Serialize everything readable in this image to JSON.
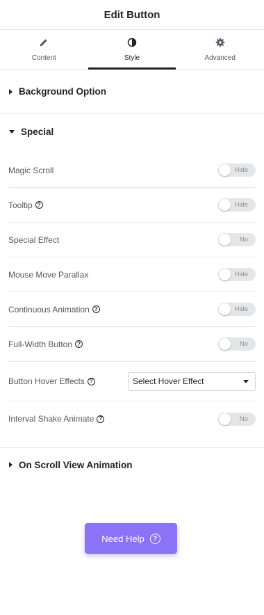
{
  "header": {
    "title": "Edit Button"
  },
  "tabs": [
    {
      "label": "Content",
      "icon": "pencil-icon"
    },
    {
      "label": "Style",
      "icon": "contrast-icon"
    },
    {
      "label": "Advanced",
      "icon": "gear-icon"
    }
  ],
  "active_tab": "Style",
  "sections": {
    "background": {
      "title": "Background Option"
    },
    "special": {
      "title": "Special",
      "rows": [
        {
          "label": "Magic Scroll",
          "toggle": "Hide"
        },
        {
          "label": "Tooltip",
          "toggle": "Hide"
        },
        {
          "label": "Special Effect",
          "toggle": "No"
        },
        {
          "label": "Mouse Move Parallax",
          "toggle": "Hide"
        },
        {
          "label": "Continuous Animation",
          "toggle": "Hide"
        },
        {
          "label": "Full-Width Button",
          "toggle": "No"
        },
        {
          "label": "Button Hover Effects",
          "select": "Select Hover Effect"
        },
        {
          "label": "Interval Shake Animate",
          "toggle": "No"
        }
      ]
    },
    "scroll": {
      "title": "On Scroll View Animation"
    }
  },
  "help_button": {
    "label": "Need Help",
    "icon": "question-circle-icon"
  },
  "help_glyph": "?",
  "colors": {
    "accent": "#8a73f6",
    "text": "#1f2124",
    "muted": "#515962"
  }
}
